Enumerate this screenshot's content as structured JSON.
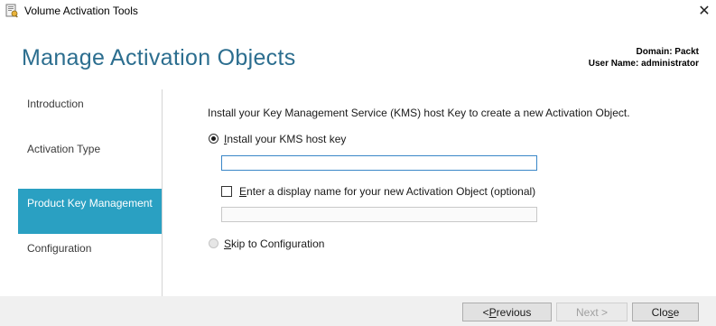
{
  "window": {
    "title": "Volume Activation Tools",
    "close_glyph": "✕",
    "icon": "volume-activation-app-icon"
  },
  "header": {
    "page_title": "Manage Activation Objects",
    "domain_line": "Domain: Packt",
    "user_line": "User Name: administrator"
  },
  "nav": {
    "items": [
      {
        "label": "Introduction",
        "active": false
      },
      {
        "label": "Activation Type",
        "active": false
      },
      {
        "label": "Product Key Management",
        "active": true
      },
      {
        "label": "Configuration",
        "active": false
      }
    ]
  },
  "main": {
    "intro": "Install your Key Management Service (KMS) host Key to create a new Activation Object.",
    "install_option": {
      "pre": "",
      "mnemonic": "I",
      "post": "nstall your KMS host key",
      "selected": true
    },
    "host_key_value": "",
    "display_name_option": {
      "pre": "",
      "mnemonic": "E",
      "post": "nter a display name for your new Activation Object (optional)",
      "checked": false
    },
    "display_name_value": "",
    "skip_option": {
      "pre": "",
      "mnemonic": "S",
      "post": "kip to Configuration",
      "selected": false
    }
  },
  "footer": {
    "previous": {
      "pre": "< ",
      "mnemonic": "P",
      "post": "revious",
      "enabled": true
    },
    "next": {
      "label": "Next >",
      "enabled": false
    },
    "close": {
      "pre": "Clo",
      "mnemonic": "s",
      "post": "e",
      "enabled": true
    }
  },
  "colors": {
    "title_blue": "#2c6e8f",
    "nav_active_bg": "#2aa0c2",
    "footer_bg": "#f0f0f0"
  }
}
